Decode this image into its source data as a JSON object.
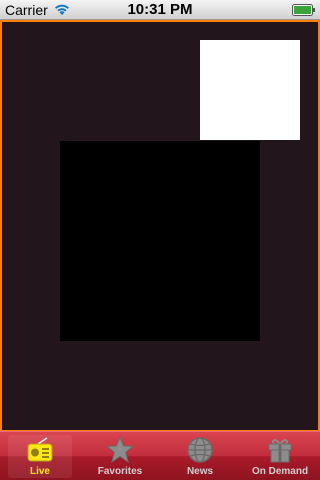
{
  "status_bar": {
    "carrier": "Carrier",
    "time": "10:31 PM",
    "wifi_icon": "wifi-icon",
    "battery_icon": "battery-icon"
  },
  "content": {
    "background": "#22151c",
    "border_color": "#ff7e00"
  },
  "tabs": [
    {
      "label": "Live",
      "icon": "radio-icon",
      "active": true
    },
    {
      "label": "Favorites",
      "icon": "star-icon",
      "active": false
    },
    {
      "label": "News",
      "icon": "globe-icon",
      "active": false
    },
    {
      "label": "On Demand",
      "icon": "gift-icon",
      "active": false
    }
  ],
  "colors": {
    "tab_active_label": "#ffe600",
    "tab_bar": "#c22d3d"
  }
}
